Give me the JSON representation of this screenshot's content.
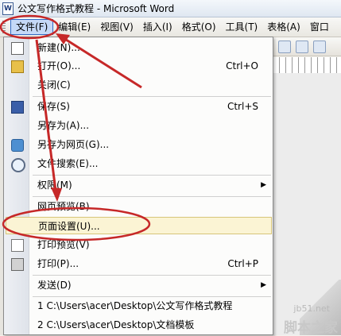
{
  "window": {
    "title": "公文写作格式教程 - Microsoft Word",
    "app_icon": "W"
  },
  "menubar": {
    "items": [
      {
        "label": "文件(F)",
        "active": true
      },
      {
        "label": "编辑(E)"
      },
      {
        "label": "视图(V)"
      },
      {
        "label": "插入(I)"
      },
      {
        "label": "格式(O)"
      },
      {
        "label": "工具(T)"
      },
      {
        "label": "表格(A)"
      },
      {
        "label": "窗口"
      }
    ]
  },
  "file_menu": {
    "new": {
      "label": "新建(N)..."
    },
    "open": {
      "label": "打开(O)...",
      "shortcut": "Ctrl+O"
    },
    "close": {
      "label": "关闭(C)"
    },
    "save": {
      "label": "保存(S)",
      "shortcut": "Ctrl+S"
    },
    "save_as": {
      "label": "另存为(A)..."
    },
    "save_as_web": {
      "label": "另存为网页(G)..."
    },
    "file_search": {
      "label": "文件搜索(E)..."
    },
    "permission": {
      "label": "权限(M)"
    },
    "web_preview": {
      "label": "网页预览(B)"
    },
    "page_setup": {
      "label": "页面设置(U)..."
    },
    "print_preview": {
      "label": "打印预览(V)"
    },
    "print": {
      "label": "打印(P)...",
      "shortcut": "Ctrl+P"
    },
    "send": {
      "label": "发送(D)"
    },
    "recent1": {
      "label": "1 C:\\Users\\acer\\Desktop\\公文写作格式教程"
    },
    "recent2": {
      "label": "2 C:\\Users\\acer\\Desktop\\文档模板"
    }
  },
  "watermark": {
    "line1": "jb51.net",
    "line2": "脚本之家"
  },
  "colors": {
    "annotation": "#c62828",
    "highlight": "#fbf4d4",
    "active_menu": "#c5d9f7"
  }
}
